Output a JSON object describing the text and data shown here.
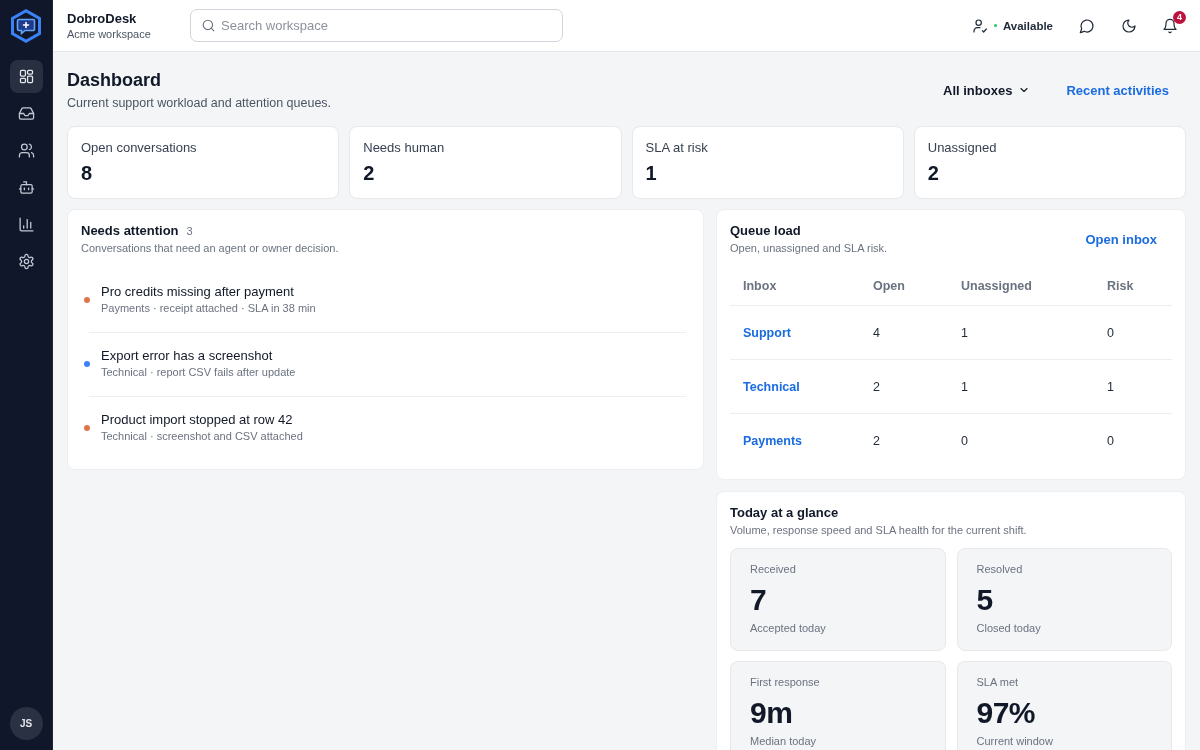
{
  "sidebar": {
    "nav": [
      {
        "kind": "dashboard",
        "selected": true
      },
      {
        "kind": "inbox",
        "selected": false
      },
      {
        "kind": "contacts",
        "selected": false
      },
      {
        "kind": "bots",
        "selected": false
      },
      {
        "kind": "reports",
        "selected": false
      },
      {
        "kind": "settings",
        "selected": false
      }
    ],
    "avatar": "JS"
  },
  "header": {
    "brand": "DobroDesk",
    "workspace": "Acme workspace",
    "search": {
      "placeholder": "Search workspace"
    },
    "status": "Available",
    "notifications": "4"
  },
  "page": {
    "title": "Dashboard",
    "subtitle": "Current support workload and attention queues.",
    "filter": "All inboxes",
    "link": "Recent activities"
  },
  "stats": [
    {
      "label": "Open conversations",
      "value": "8"
    },
    {
      "label": "Needs human",
      "value": "2"
    },
    {
      "label": "SLA at risk",
      "value": "1"
    },
    {
      "label": "Unassigned",
      "value": "2"
    }
  ],
  "attention": {
    "title": "Needs attention",
    "count": "3",
    "subtitle": "Conversations that need an agent or owner decision.",
    "items": [
      {
        "title": "Pro credits missing after payment",
        "meta": "Payments · receipt attached · SLA in 38 min",
        "color": "#e0754c"
      },
      {
        "title": "Export error has a screenshot",
        "meta": "Technical · report CSV fails after update",
        "color": "#3b82f6"
      },
      {
        "title": "Product import stopped at row 42",
        "meta": "Technical · screenshot and CSV attached",
        "color": "#e0754c"
      }
    ]
  },
  "queue": {
    "title": "Queue load",
    "subtitle": "Open, unassigned and SLA risk.",
    "link": "Open inbox",
    "columns": [
      "Inbox",
      "Open",
      "Unassigned",
      "Risk"
    ],
    "rows": [
      {
        "inbox": "Support",
        "open": "4",
        "unassigned": "1",
        "risk": "0"
      },
      {
        "inbox": "Technical",
        "open": "2",
        "unassigned": "1",
        "risk": "1"
      },
      {
        "inbox": "Payments",
        "open": "2",
        "unassigned": "0",
        "risk": "0"
      }
    ]
  },
  "glance": {
    "title": "Today at a glance",
    "subtitle": "Volume, response speed and SLA health for the current shift.",
    "tiles": [
      {
        "label": "Received",
        "value": "7",
        "note": "Accepted today"
      },
      {
        "label": "Resolved",
        "value": "5",
        "note": "Closed today"
      },
      {
        "label": "First response",
        "value": "9m",
        "note": "Median today"
      },
      {
        "label": "SLA met",
        "value": "97%",
        "note": "Current window"
      }
    ]
  }
}
